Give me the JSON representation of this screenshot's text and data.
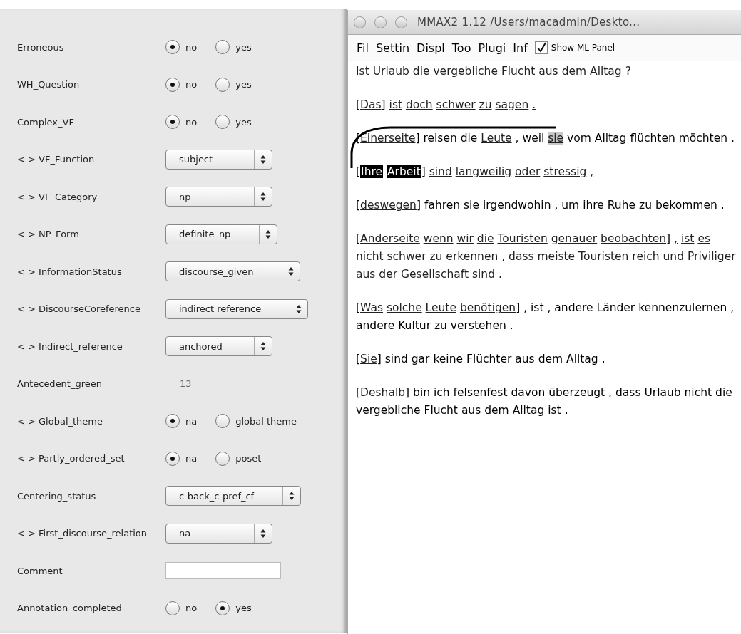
{
  "annotation_panel": {
    "rows": [
      {
        "label": "Erroneous",
        "kind": "radio",
        "options": [
          {
            "label": "no",
            "selected": true
          },
          {
            "label": "yes",
            "selected": false
          }
        ]
      },
      {
        "label": "WH_Question",
        "kind": "radio",
        "options": [
          {
            "label": "no",
            "selected": true
          },
          {
            "label": "yes",
            "selected": false
          }
        ]
      },
      {
        "label": "Complex_VF",
        "kind": "radio",
        "options": [
          {
            "label": "no",
            "selected": true
          },
          {
            "label": "yes",
            "selected": false
          }
        ]
      },
      {
        "label": "< > VF_Function",
        "kind": "select",
        "value": "subject"
      },
      {
        "label": "< > VF_Category",
        "kind": "select",
        "value": "np"
      },
      {
        "label": "< > NP_Form",
        "kind": "select",
        "value": "definite_np"
      },
      {
        "label": "< > InformationStatus",
        "kind": "select",
        "value": "discourse_given"
      },
      {
        "label": "< > DiscourseCoreference",
        "kind": "select",
        "value": "indirect reference"
      },
      {
        "label": "< > Indirect_reference",
        "kind": "select",
        "value": "anchored"
      },
      {
        "label": "Antecedent_green",
        "kind": "value",
        "value": "13"
      },
      {
        "label": "< > Global_theme",
        "kind": "radio",
        "options": [
          {
            "label": "na",
            "selected": true
          },
          {
            "label": "global theme",
            "selected": false
          }
        ]
      },
      {
        "label": "< > Partly_ordered_set",
        "kind": "radio",
        "options": [
          {
            "label": "na",
            "selected": true
          },
          {
            "label": "poset",
            "selected": false
          }
        ]
      },
      {
        "label": "Centering_status",
        "kind": "select",
        "value": "c-back_c-pref_cf"
      },
      {
        "label": "< > First_discourse_relation",
        "kind": "select",
        "value": "na"
      },
      {
        "label": "Comment",
        "kind": "text"
      },
      {
        "label": "Annotation_completed",
        "kind": "radio",
        "options": [
          {
            "label": "no",
            "selected": false
          },
          {
            "label": "yes",
            "selected": true
          }
        ]
      }
    ]
  },
  "window": {
    "title": "MMAX2 1.12 /Users/macadmin/Deskto...",
    "menu": [
      "Fil",
      "Settin",
      "Displ",
      "Too",
      "Plugi",
      "Inf"
    ],
    "show_ml_panel": {
      "label": "Show ML Panel",
      "checked": true
    },
    "paragraphs": [
      [
        {
          "text": "Ist",
          "kind": "markable"
        },
        {
          "text": "Urlaub",
          "kind": "markable"
        },
        {
          "text": "die",
          "kind": "markable"
        },
        {
          "text": "vergebliche",
          "kind": "markable"
        },
        {
          "text": "Flucht",
          "kind": "markable"
        },
        {
          "text": "aus",
          "kind": "markable"
        },
        {
          "text": "dem",
          "kind": "markable"
        },
        {
          "text": "Alltag",
          "kind": "markable"
        },
        {
          "text": "?",
          "kind": "markable"
        }
      ],
      [
        {
          "text": "[",
          "kind": "open"
        },
        {
          "text": "Das",
          "kind": "markable"
        },
        {
          "text": "]",
          "kind": "close"
        },
        {
          "text": "ist",
          "kind": "markable"
        },
        {
          "text": "doch",
          "kind": "markable"
        },
        {
          "text": "schwer",
          "kind": "markable"
        },
        {
          "text": "zu",
          "kind": "markable"
        },
        {
          "text": "sagen",
          "kind": "markable"
        },
        {
          "text": ".",
          "kind": "markable"
        }
      ],
      [
        {
          "text": "[",
          "kind": "open"
        },
        {
          "text": "Einerseite",
          "kind": "markable"
        },
        {
          "text": "]",
          "kind": "close"
        },
        {
          "text": "reisen",
          "kind": "plain"
        },
        {
          "text": "die",
          "kind": "plain"
        },
        {
          "text": "Leute",
          "kind": "markable"
        },
        {
          "text": ",",
          "kind": "plain"
        },
        {
          "text": "weil",
          "kind": "plain"
        },
        {
          "text": "sie",
          "kind": "focus"
        },
        {
          "text": "vom",
          "kind": "plain"
        },
        {
          "text": "Alltag",
          "kind": "plain"
        },
        {
          "text": "flüchten",
          "kind": "plain"
        },
        {
          "text": "möchten",
          "kind": "plain"
        },
        {
          "text": ".",
          "kind": "plain"
        }
      ],
      [
        {
          "text": "[",
          "kind": "open"
        },
        {
          "text": "Ihre",
          "kind": "selected"
        },
        {
          "text": "Arbeit",
          "kind": "selected"
        },
        {
          "text": "]",
          "kind": "close"
        },
        {
          "text": "sind",
          "kind": "markable"
        },
        {
          "text": "langweilig",
          "kind": "markable"
        },
        {
          "text": "oder",
          "kind": "markable"
        },
        {
          "text": "stressig",
          "kind": "markable"
        },
        {
          "text": ",",
          "kind": "markable"
        }
      ],
      [
        {
          "text": "[",
          "kind": "open"
        },
        {
          "text": "deswegen",
          "kind": "markable"
        },
        {
          "text": "]",
          "kind": "close"
        },
        {
          "text": "fahren",
          "kind": "plain"
        },
        {
          "text": "sie",
          "kind": "plain"
        },
        {
          "text": "irgendwohin",
          "kind": "plain"
        },
        {
          "text": ",",
          "kind": "plain"
        },
        {
          "text": "um",
          "kind": "plain"
        },
        {
          "text": "ihre",
          "kind": "plain"
        },
        {
          "text": "Ruhe",
          "kind": "plain"
        },
        {
          "text": "zu",
          "kind": "plain"
        },
        {
          "text": "bekommen",
          "kind": "plain"
        },
        {
          "text": ".",
          "kind": "plain"
        }
      ],
      [
        {
          "text": "[",
          "kind": "open"
        },
        {
          "text": "Anderseite",
          "kind": "markable"
        },
        {
          "text": "wenn",
          "kind": "markable"
        },
        {
          "text": "wir",
          "kind": "markable"
        },
        {
          "text": "die",
          "kind": "markable"
        },
        {
          "text": "Touristen",
          "kind": "markable"
        },
        {
          "text": "genauer",
          "kind": "markable"
        },
        {
          "text": "beobachten",
          "kind": "markable"
        },
        {
          "text": "]",
          "kind": "close"
        },
        {
          "text": ",",
          "kind": "markable"
        },
        {
          "text": "ist",
          "kind": "markable"
        },
        {
          "text": "es",
          "kind": "markable"
        },
        {
          "text": "nicht",
          "kind": "markable"
        },
        {
          "text": "schwer",
          "kind": "markable"
        },
        {
          "text": "zu",
          "kind": "markable"
        },
        {
          "text": "erkennen",
          "kind": "markable"
        },
        {
          "text": ",",
          "kind": "markable"
        },
        {
          "text": "dass",
          "kind": "markable"
        },
        {
          "text": "meiste",
          "kind": "markable"
        },
        {
          "text": "Touristen",
          "kind": "markable"
        },
        {
          "text": "reich",
          "kind": "markable"
        },
        {
          "text": "und",
          "kind": "markable"
        },
        {
          "text": "Priviliger",
          "kind": "markable"
        },
        {
          "text": "aus",
          "kind": "markable"
        },
        {
          "text": "der",
          "kind": "markable"
        },
        {
          "text": "Gesellschaft",
          "kind": "markable"
        },
        {
          "text": "sind",
          "kind": "markable"
        },
        {
          "text": ".",
          "kind": "markable"
        }
      ],
      [
        {
          "text": "[",
          "kind": "open"
        },
        {
          "text": "Was",
          "kind": "markable"
        },
        {
          "text": "solche",
          "kind": "markable"
        },
        {
          "text": "Leute",
          "kind": "markable"
        },
        {
          "text": "benötigen",
          "kind": "markable"
        },
        {
          "text": "]",
          "kind": "close"
        },
        {
          "text": ",",
          "kind": "plain"
        },
        {
          "text": "ist",
          "kind": "plain"
        },
        {
          "text": ",",
          "kind": "plain"
        },
        {
          "text": "andere",
          "kind": "plain"
        },
        {
          "text": "Länder",
          "kind": "plain"
        },
        {
          "text": "kennenzulernen",
          "kind": "plain"
        },
        {
          "text": ",",
          "kind": "plain"
        },
        {
          "text": "andere",
          "kind": "plain"
        },
        {
          "text": "Kultur",
          "kind": "plain"
        },
        {
          "text": "zu",
          "kind": "plain"
        },
        {
          "text": "verstehen",
          "kind": "plain"
        },
        {
          "text": ".",
          "kind": "plain"
        }
      ],
      [
        {
          "text": "[",
          "kind": "open"
        },
        {
          "text": "Sie",
          "kind": "markable"
        },
        {
          "text": "]",
          "kind": "close"
        },
        {
          "text": "sind",
          "kind": "plain"
        },
        {
          "text": "gar",
          "kind": "plain"
        },
        {
          "text": "keine",
          "kind": "plain"
        },
        {
          "text": "Flüchter",
          "kind": "plain"
        },
        {
          "text": "aus",
          "kind": "plain"
        },
        {
          "text": "dem",
          "kind": "plain"
        },
        {
          "text": "Alltag",
          "kind": "plain"
        },
        {
          "text": ".",
          "kind": "plain"
        }
      ],
      [
        {
          "text": "[",
          "kind": "open"
        },
        {
          "text": "Deshalb",
          "kind": "markable"
        },
        {
          "text": "]",
          "kind": "close"
        },
        {
          "text": "bin",
          "kind": "plain"
        },
        {
          "text": "ich",
          "kind": "plain"
        },
        {
          "text": "felsenfest",
          "kind": "plain"
        },
        {
          "text": "davon",
          "kind": "plain"
        },
        {
          "text": "überzeugt",
          "kind": "plain"
        },
        {
          "text": ",",
          "kind": "plain"
        },
        {
          "text": "dass",
          "kind": "plain"
        },
        {
          "text": "Urlaub",
          "kind": "plain"
        },
        {
          "text": "nicht",
          "kind": "plain"
        },
        {
          "text": "die",
          "kind": "plain"
        },
        {
          "text": "vergebliche",
          "kind": "plain"
        },
        {
          "text": "Flucht",
          "kind": "plain"
        },
        {
          "text": "aus",
          "kind": "plain"
        },
        {
          "text": "dem",
          "kind": "plain"
        },
        {
          "text": "Alltag",
          "kind": "plain"
        },
        {
          "text": "ist",
          "kind": "plain"
        },
        {
          "text": ".",
          "kind": "plain"
        }
      ]
    ]
  }
}
